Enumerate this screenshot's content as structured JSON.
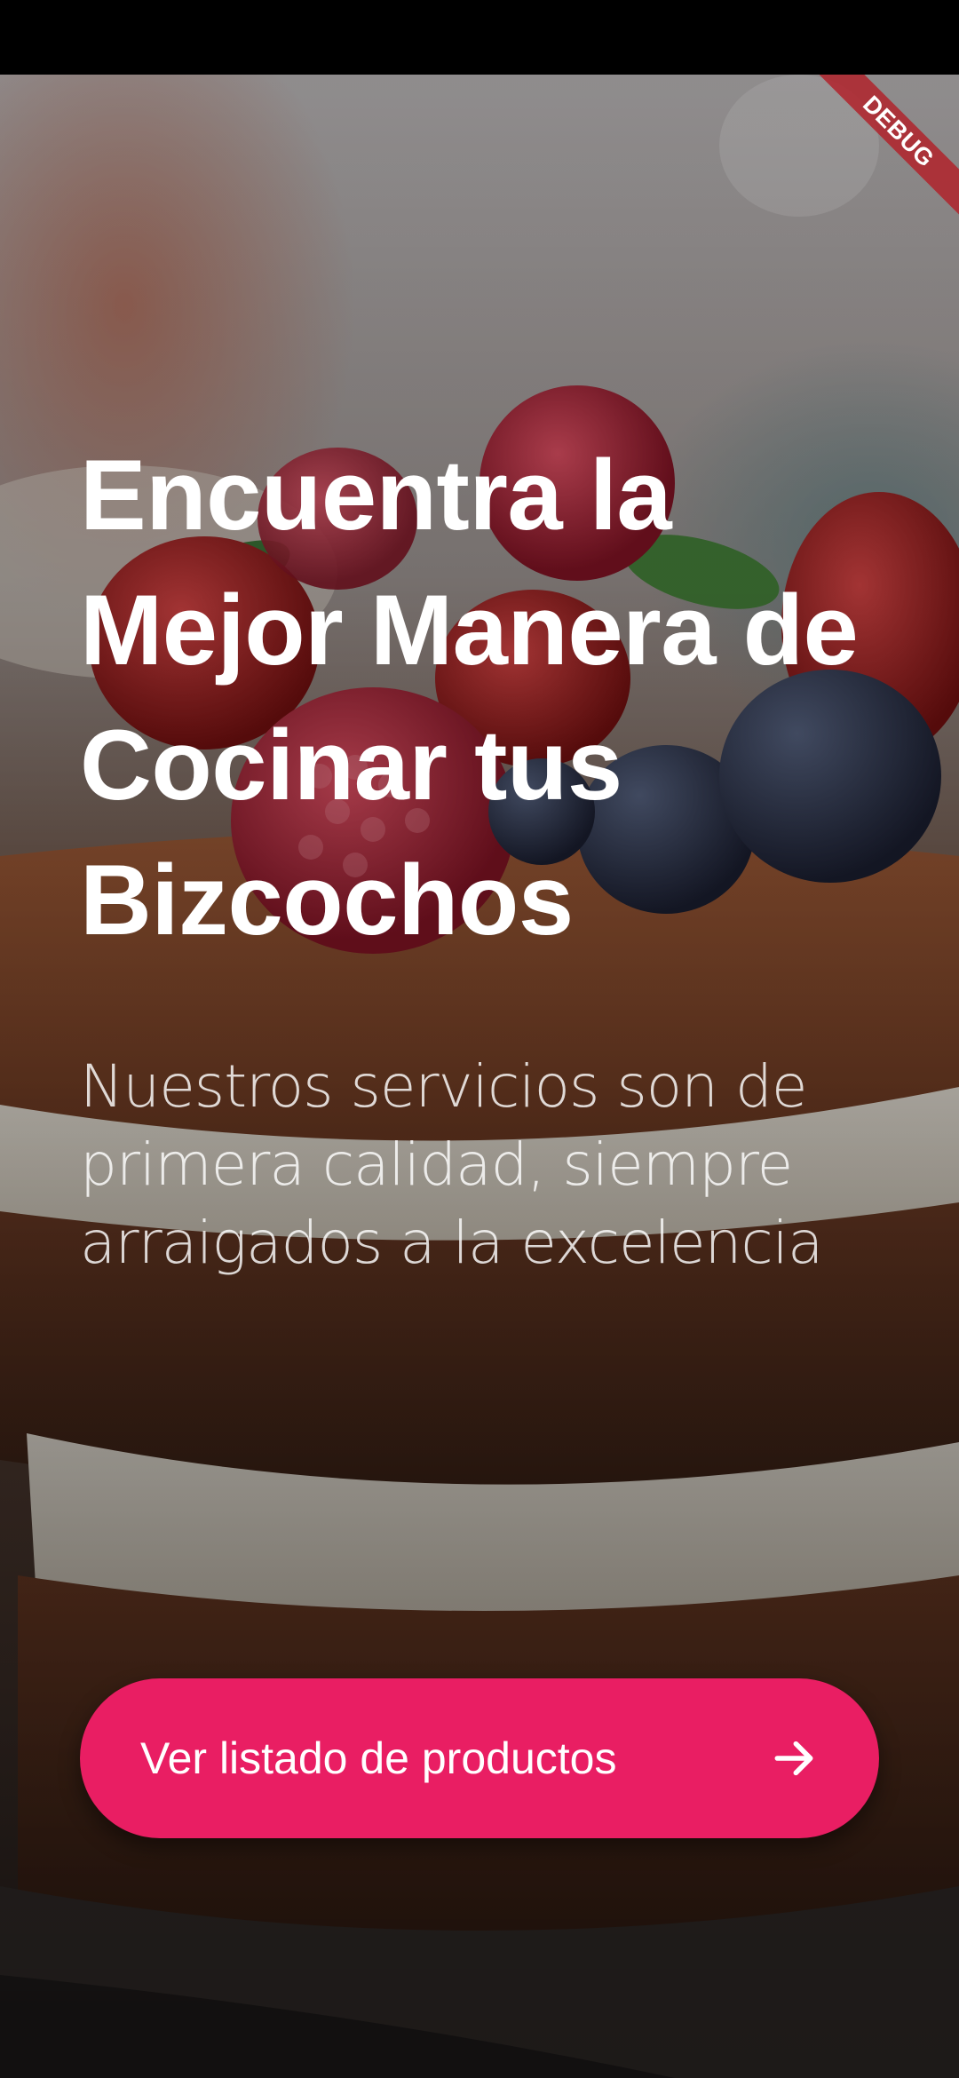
{
  "hero": {
    "headline": "Encuentra la Mejor Manera de Cocinar tus Bizcochos",
    "subtitle": "Nuestros servicios son de primera calidad, siempre arraigados a la excelencia"
  },
  "cta": {
    "label": "Ver listado de productos",
    "icon": "arrow-right-icon"
  },
  "debug_banner": {
    "label": "DEBUG"
  },
  "colors": {
    "accent": "#e91e63",
    "debug_ribbon": "#b0232c",
    "status_bar": "#000000"
  }
}
